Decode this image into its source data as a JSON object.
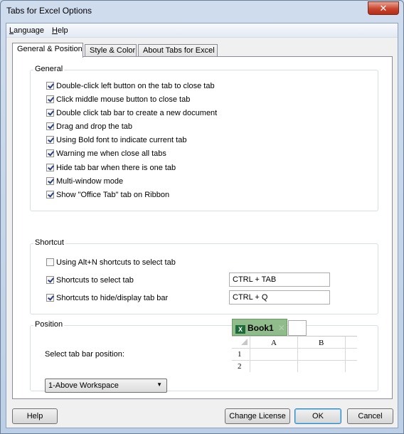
{
  "window": {
    "title": "Tabs for Excel Options",
    "close_label": "✕"
  },
  "menu": [
    {
      "label": "Language",
      "mnemonic": "L",
      "rest": "anguage"
    },
    {
      "label": "Help",
      "mnemonic": "H",
      "rest": "elp"
    }
  ],
  "tabs": [
    {
      "label": "General & Position",
      "active": true
    },
    {
      "label": "Style & Color",
      "active": false
    },
    {
      "label": "About Tabs for Excel",
      "active": false
    }
  ],
  "general": {
    "title": "General",
    "options": [
      {
        "label": "Double-click left button on the tab to close tab",
        "checked": true
      },
      {
        "label": "Click middle mouse button to close tab",
        "checked": true
      },
      {
        "label": "Double click tab bar to create a new document",
        "checked": true
      },
      {
        "label": "Drag and drop the tab",
        "checked": true
      },
      {
        "label": "Using Bold font to indicate current tab",
        "checked": true
      },
      {
        "label": "Warning me when close all tabs",
        "checked": true
      },
      {
        "label": "Hide tab bar when there is one tab",
        "checked": true
      },
      {
        "label": "Multi-window mode",
        "checked": true
      },
      {
        "label": "Show \"Office Tab\" tab on Ribbon",
        "checked": true
      }
    ]
  },
  "shortcut": {
    "title": "Shortcut",
    "alt_n": {
      "label": "Using Alt+N shortcuts to select tab",
      "checked": false
    },
    "select_tab": {
      "label": "Shortcuts to select tab",
      "checked": true,
      "value": "CTRL + TAB"
    },
    "hide_display": {
      "label": "Shortcuts to hide/display tab bar",
      "checked": true,
      "value": "CTRL + Q"
    }
  },
  "position": {
    "title": "Position",
    "label": "Select tab bar position:",
    "selected": "1-Above Workspace",
    "preview": {
      "tab_label": "Book1",
      "tab_close": "✕",
      "columns": [
        "A",
        "B"
      ],
      "rows": [
        "1",
        "2"
      ]
    }
  },
  "buttons": {
    "help": "Help",
    "change_license": "Change License",
    "ok": "OK",
    "cancel": "Cancel"
  }
}
